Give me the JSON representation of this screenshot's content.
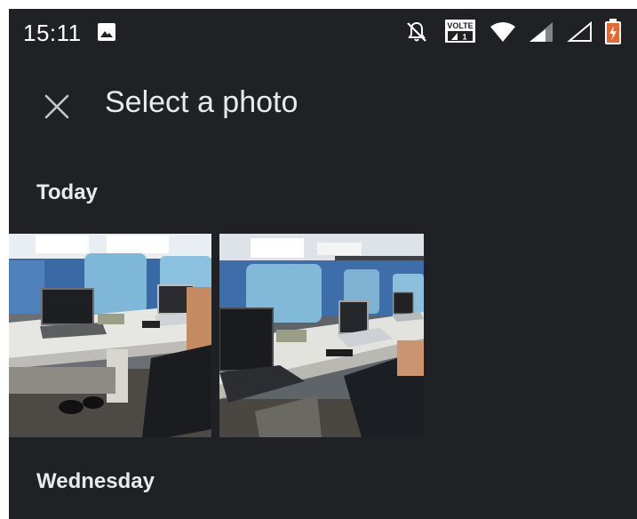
{
  "status_bar": {
    "time": "15:11",
    "volte_label": "VOLTE",
    "volte_sub": "1",
    "icons": [
      "image-icon",
      "bell-off-icon",
      "volte-icon",
      "wifi-icon",
      "signal-icon",
      "signal-empty-icon",
      "battery-charging-icon"
    ]
  },
  "app_bar": {
    "close_icon": "close-icon",
    "title": "Select a photo"
  },
  "sections": [
    {
      "label": "Today"
    },
    {
      "label": "Wednesday"
    }
  ],
  "colors": {
    "background": "#202124",
    "text": "#e8eaed",
    "battery_accent": "#e8672e"
  }
}
